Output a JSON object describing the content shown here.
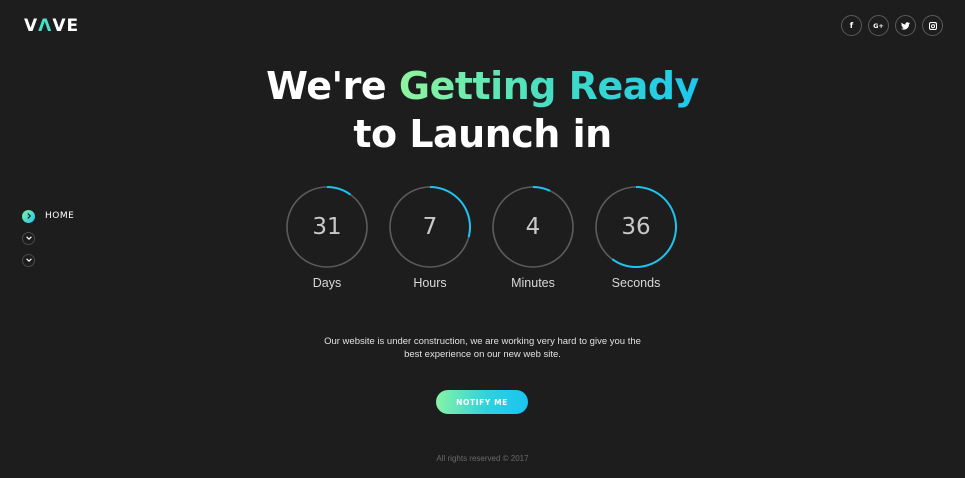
{
  "brand": {
    "logo_prefix": "V",
    "logo_accent": "Λ",
    "logo_suffix": "VE"
  },
  "social": [
    {
      "icon": "facebook-icon",
      "glyph": "f"
    },
    {
      "icon": "google-plus-icon",
      "glyph": "G+"
    },
    {
      "icon": "twitter-icon",
      "glyph": ""
    },
    {
      "icon": "instagram-icon",
      "glyph": ""
    }
  ],
  "sidenav": {
    "items": [
      {
        "label": "HOME",
        "active": true
      },
      {
        "label": "",
        "active": false
      },
      {
        "label": "",
        "active": false
      }
    ]
  },
  "headline": {
    "part1": "We're",
    "highlight": "Getting Ready",
    "line2": "to Launch in"
  },
  "countdown": [
    {
      "value": "31",
      "label": "Days",
      "progress": 0.1
    },
    {
      "value": "7",
      "label": "Hours",
      "progress": 0.29
    },
    {
      "value": "4",
      "label": "Minutes",
      "progress": 0.07
    },
    {
      "value": "36",
      "label": "Seconds",
      "progress": 0.6
    }
  ],
  "description": {
    "line1": "Our website is under construction, we are working very hard to give you the",
    "line2": "best experience on our new web site."
  },
  "cta": {
    "label": "NOTIFY ME"
  },
  "footer": {
    "text": "All rights reserved © 2017"
  },
  "colors": {
    "background": "#1d1d1e",
    "ring_track": "#5c5c5e",
    "ring_progress": "#1fc3f0",
    "accent_start": "#8ff59d",
    "accent_end": "#1cc7ef"
  }
}
